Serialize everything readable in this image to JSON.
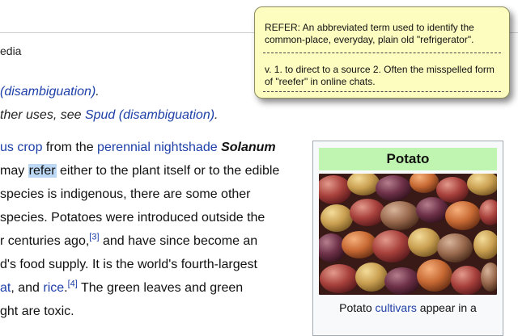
{
  "page": {
    "subtitle": "edia",
    "hatnote1": {
      "link": "(disambiguation)",
      "suffix": "."
    },
    "hatnote2": {
      "prefix": "ther uses, see ",
      "link": "Spud (disambiguation)",
      "suffix": "."
    },
    "lines": {
      "l1": {
        "link1": "us crop",
        "text1": " from the ",
        "link2": "perennial nightshade",
        "text2": " ",
        "bold": "Solanum"
      },
      "l2": {
        "text1": " may ",
        "hl": "refer",
        "text2": " either to the plant itself or to the edible"
      },
      "l3": "species is indigenous, there are some other",
      "l4": " species. Potatoes were introduced outside the",
      "l5": {
        "text1": "r centuries ago,",
        "sup": "[3]",
        "text2": " and have since become an"
      },
      "l6": "d's food supply. It is the world's fourth-largest",
      "l7": {
        "link1": "at",
        "text1": ", and ",
        "link2": "rice",
        "text2": ".",
        "sup": "[4]",
        "text3": " The green leaves and green"
      },
      "l8": "ght are toxic."
    }
  },
  "infobox": {
    "title": "Potato",
    "caption_prefix": "Potato ",
    "caption_link": "cultivars",
    "caption_suffix": " appear in a"
  },
  "popup": {
    "definition1": "REFER:  An abbreviated term used to identify the common-place, everyday, plain old \"refrigerator\".",
    "definition2": "v.    1. to direct to a source  2. Often the misspelled form of \"reefer\" in online chats."
  },
  "colors": {
    "link": "#1d3fa8",
    "highlight": "#bcd8f5",
    "popup_bg": "#fdfdc0",
    "infobox_title_bg": "#bff5b0"
  }
}
